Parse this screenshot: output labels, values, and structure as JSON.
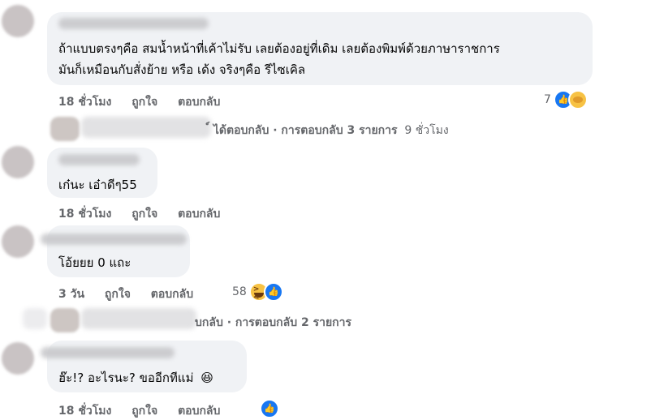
{
  "comments": [
    {
      "lines": [
        "ถ้าแบบตรงๆคือ สมน้ำหน้าที่เค้าไม่รับ เลยต้องอยู่ที่เดิม เลยต้องพิมพ์ด้วยภาษาราชการ",
        "มันก็เหมือนกับสั่งย้าย หรือ เด้ง จริงๆคือ รีไซเคิล"
      ],
      "time": "18 ชั่วโมง",
      "like": "ถูกใจ",
      "reply": "ตอบกลับ",
      "reaction_count": "7",
      "reaction_icons": [
        "like-icon",
        "care-icon"
      ]
    },
    {
      "lines": [
        "เก๋นะ เอ๋าดีๆ55"
      ],
      "time": "18 ชั่วโมง",
      "like": "ถูกใจ",
      "reply": "ตอบกลับ"
    },
    {
      "lines": [
        "โอ้ยยย 0 แถะ"
      ],
      "time": "3 วัน",
      "like": "ถูกใจ",
      "reply": "ตอบกลับ",
      "reaction_count": "58",
      "reaction_icons": [
        "haha-icon",
        "like-icon"
      ]
    },
    {
      "lines": [
        "ฮ๊ะ!? อะไรนะ? ขออีกทีแม่"
      ],
      "emoji": "😆",
      "time": "18 ชั่วโมง",
      "like": "ถูกใจ",
      "reply": "ตอบกลับ",
      "reaction_icons": [
        "like-icon"
      ]
    }
  ],
  "reply_threads": [
    {
      "text": "์ ได้ตอบกลับ · การตอบกลับ 3 รายการ",
      "time": "9 ชั่วโมง"
    },
    {
      "text": "บกลับ · การตอบกลับ 2 รายการ"
    }
  ],
  "colors": {
    "bubble": "#f0f2f5",
    "meta": "#65676b",
    "like_blue": "#1877f2"
  }
}
